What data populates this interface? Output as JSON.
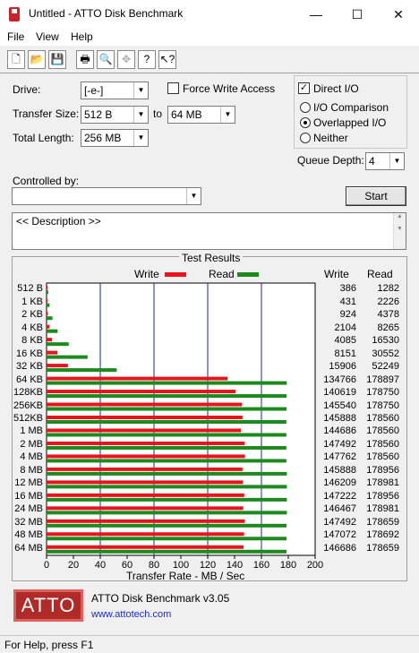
{
  "window": {
    "title": "Untitled - ATTO Disk Benchmark",
    "min": "—",
    "max": "☐",
    "close": "✕"
  },
  "menu": {
    "file": "File",
    "view": "View",
    "help": "Help"
  },
  "toolbar": {
    "icons": [
      "new-icon",
      "open-icon",
      "save-icon",
      "print-icon",
      "print-preview-icon",
      "move-icon",
      "about-icon",
      "context-help-icon"
    ]
  },
  "settings": {
    "drive_label": "Drive:",
    "drive_value": "[-e-]",
    "force_write_label": "Force Write Access",
    "force_write_checked": false,
    "direct_io_label": "Direct I/O",
    "direct_io_checked": true,
    "transfer_size_label": "Transfer Size:",
    "transfer_from": "512 B",
    "to_label": "to",
    "transfer_to": "64 MB",
    "total_length_label": "Total Length:",
    "total_length_value": "256 MB",
    "io_comparison_label": "I/O Comparison",
    "overlapped_io_label": "Overlapped I/O",
    "neither_label": "Neither",
    "selected_mode": "Overlapped I/O",
    "queue_depth_label": "Queue Depth:",
    "queue_depth_value": "4",
    "controlled_by_label": "Controlled by:",
    "controlled_by_value": "",
    "start_label": "Start"
  },
  "description": {
    "text": "<< Description >>"
  },
  "results": {
    "title": "Test Results",
    "legend_write": "Write",
    "legend_read": "Read",
    "col_write": "Write",
    "col_read": "Read",
    "xlabel": "Transfer Rate - MB / Sec",
    "write_color": "#e8141c",
    "read_color": "#1d8a1d"
  },
  "chart_data": {
    "type": "bar",
    "orientation": "horizontal",
    "xlabel": "Transfer Rate - MB / Sec",
    "xlim": [
      0,
      200
    ],
    "xticks": [
      0,
      20,
      40,
      60,
      80,
      100,
      120,
      140,
      160,
      180,
      200
    ],
    "categories": [
      "512 B",
      "1 KB",
      "2 KB",
      "4 KB",
      "8 KB",
      "16 KB",
      "32 KB",
      "64 KB",
      "128KB",
      "256KB",
      "512KB",
      "1 MB",
      "2 MB",
      "4 MB",
      "8 MB",
      "12 MB",
      "16 MB",
      "24 MB",
      "32 MB",
      "48 MB",
      "64 MB"
    ],
    "series": [
      {
        "name": "Write",
        "values": [
          386,
          431,
          924,
          2104,
          4085,
          8151,
          15906,
          134766,
          140619,
          145540,
          145888,
          144686,
          147492,
          147762,
          145888,
          146209,
          147222,
          146467,
          147492,
          147072,
          146686
        ]
      },
      {
        "name": "Read",
        "values": [
          1282,
          2226,
          4378,
          8265,
          16530,
          30552,
          52249,
          178897,
          178750,
          178750,
          178560,
          178560,
          178560,
          178560,
          178956,
          178981,
          178956,
          178981,
          178659,
          178692,
          178659
        ]
      }
    ],
    "unit_note": "table values in KB/sec; bars scaled to MB/sec"
  },
  "footer": {
    "logo_text": "ATTO",
    "product": "ATTO Disk Benchmark v3.05",
    "link": "www.attotech.com"
  },
  "status": {
    "text": "For Help, press F1"
  }
}
